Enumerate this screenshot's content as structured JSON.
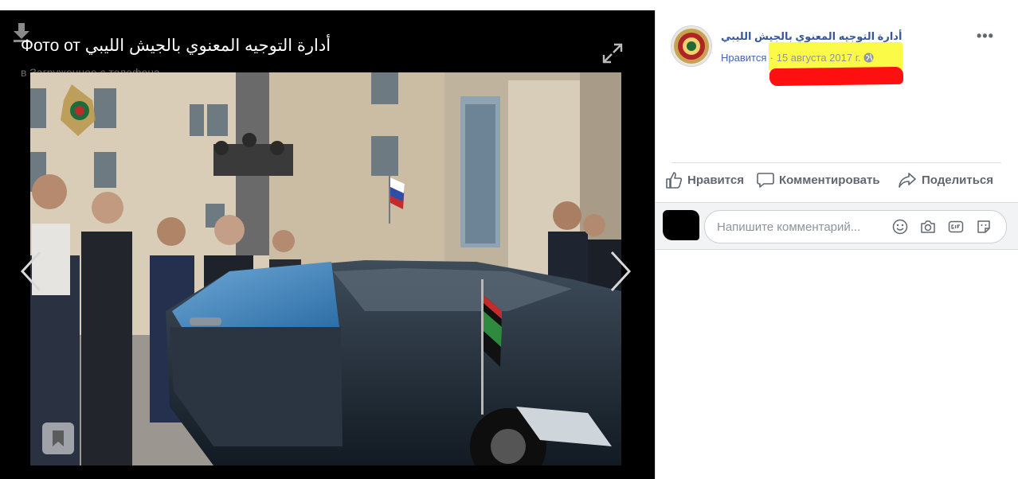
{
  "viewer": {
    "title": "Фото от أدارة التوجيه المعنوي بالجيش الليبي",
    "subtitle": "в Загруженное с телефона"
  },
  "post": {
    "page_name": "أدارة التوجيه المعنوي بالجيش الليبي",
    "like_link": "Нравится",
    "separator": "·",
    "date": "15 августа 2017 г.",
    "privacy_icon": "globe-icon",
    "more_label": "•••"
  },
  "actions": {
    "like": "Нравится",
    "comment": "Комментировать",
    "share": "Поделиться"
  },
  "comment_box": {
    "placeholder": "Напишите комментарий..."
  },
  "colors": {
    "link_blue": "#365899",
    "highlight_yellow": "#f8f800",
    "highlight_red": "#ff1010"
  }
}
